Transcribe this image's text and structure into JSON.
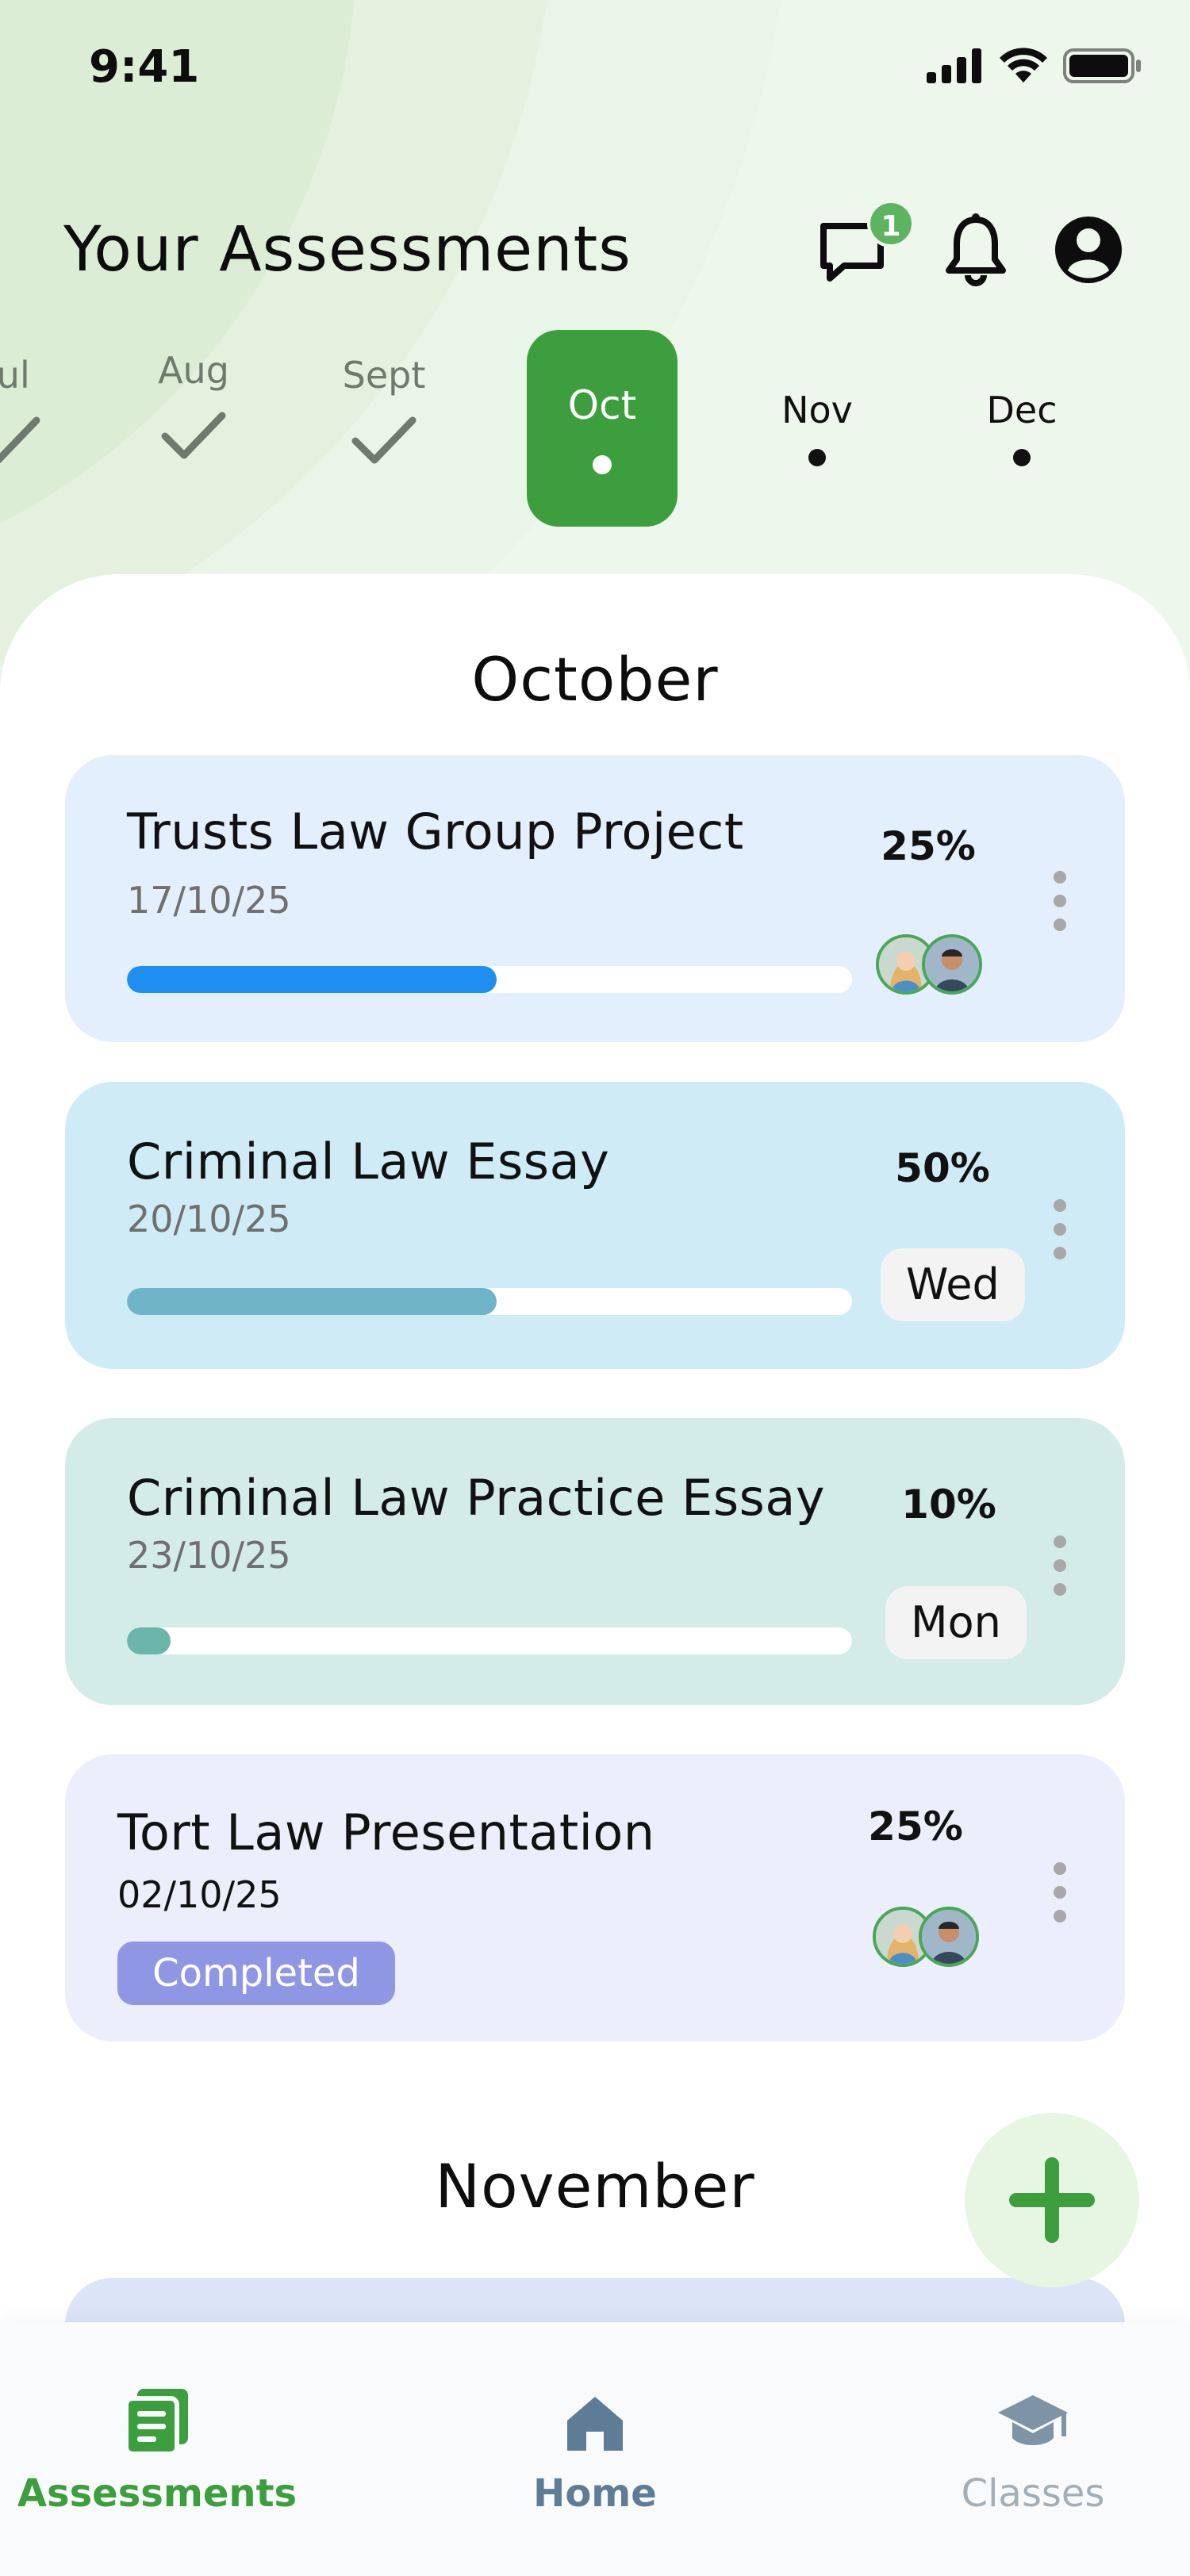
{
  "status_bar": {
    "time": "9:41"
  },
  "header": {
    "title": "Your Assessments",
    "messages_badge": "1"
  },
  "months": [
    {
      "label": "Jul",
      "state": "done"
    },
    {
      "label": "Aug",
      "state": "done"
    },
    {
      "label": "Sept",
      "state": "done"
    },
    {
      "label": "Oct",
      "state": "active"
    },
    {
      "label": "Nov",
      "state": "upcoming"
    },
    {
      "label": "Dec",
      "state": "upcoming"
    }
  ],
  "sections": [
    {
      "title": "October",
      "cards": [
        {
          "title": "Trusts Law Group Project",
          "date": "17/10/25",
          "percent": "25%",
          "progress": 0.51,
          "bg": "#e4effd",
          "bar": "#1e8ff0",
          "trailing": "avatars"
        },
        {
          "title": "Criminal Law Essay",
          "date": "20/10/25",
          "percent": "50%",
          "progress": 0.51,
          "bg": "#cfecf6",
          "bar": "#6fb4c7",
          "trailing": "Wed"
        },
        {
          "title": "Criminal Law Practice Essay",
          "date": "23/10/25",
          "percent": "10%",
          "progress": 0.06,
          "bg": "#d3ece8",
          "bar": "#6bb5ab",
          "trailing": "Mon"
        },
        {
          "title": "Tort Law Presentation",
          "date": "02/10/25",
          "percent": "25%",
          "status": "Completed",
          "bg": "#eceefc",
          "trailing": "avatars"
        }
      ]
    },
    {
      "title": "November"
    }
  ],
  "nav": {
    "assessments": "Assessments",
    "home": "Home",
    "classes": "Classes"
  },
  "colors": {
    "accent": "#3c9e3c",
    "completed": "#8f97e4"
  }
}
